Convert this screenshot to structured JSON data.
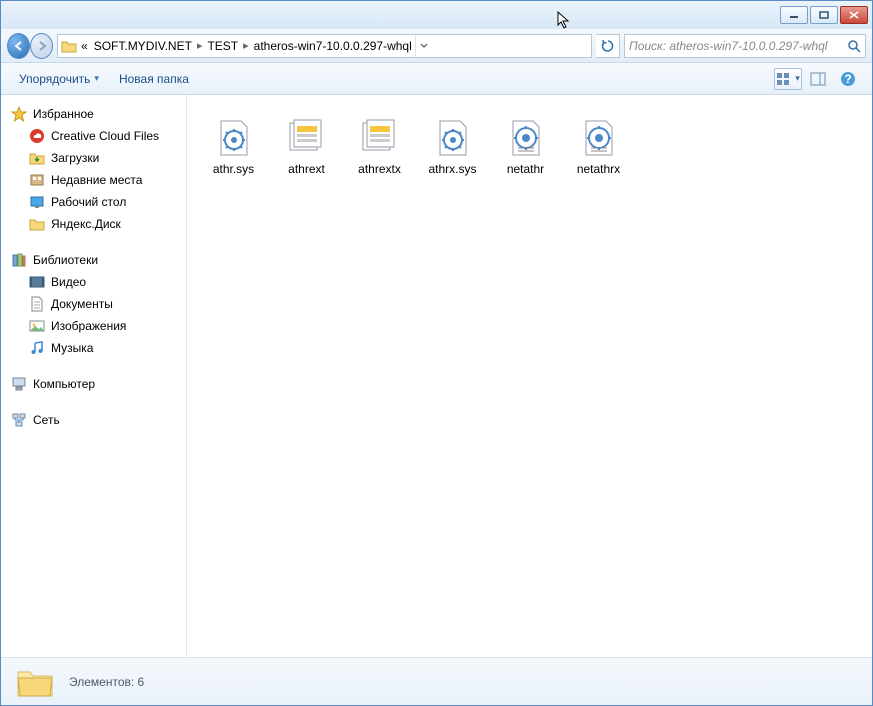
{
  "breadcrumb": {
    "prefix": "«",
    "segments": [
      "SOFT.MYDIV.NET",
      "TEST",
      "atheros-win7-10.0.0.297-whql"
    ]
  },
  "search": {
    "placeholder": "Поиск: atheros-win7-10.0.0.297-whql"
  },
  "toolbar": {
    "organize": "Упорядочить",
    "newfolder": "Новая папка"
  },
  "sidebar": {
    "favorites": {
      "label": "Избранное",
      "items": [
        "Creative Cloud Files",
        "Загрузки",
        "Недавние места",
        "Рабочий стол",
        "Яндекс.Диск"
      ]
    },
    "libraries": {
      "label": "Библиотеки",
      "items": [
        "Видео",
        "Документы",
        "Изображения",
        "Музыка"
      ]
    },
    "computer": {
      "label": "Компьютер"
    },
    "network": {
      "label": "Сеть"
    }
  },
  "files": [
    {
      "name": "athr.sys",
      "type": "sys"
    },
    {
      "name": "athrext",
      "type": "cat"
    },
    {
      "name": "athrextx",
      "type": "cat"
    },
    {
      "name": "athrx.sys",
      "type": "sys"
    },
    {
      "name": "netathr",
      "type": "inf"
    },
    {
      "name": "netathrx",
      "type": "inf"
    }
  ],
  "status": {
    "text": "Элементов: 6"
  }
}
